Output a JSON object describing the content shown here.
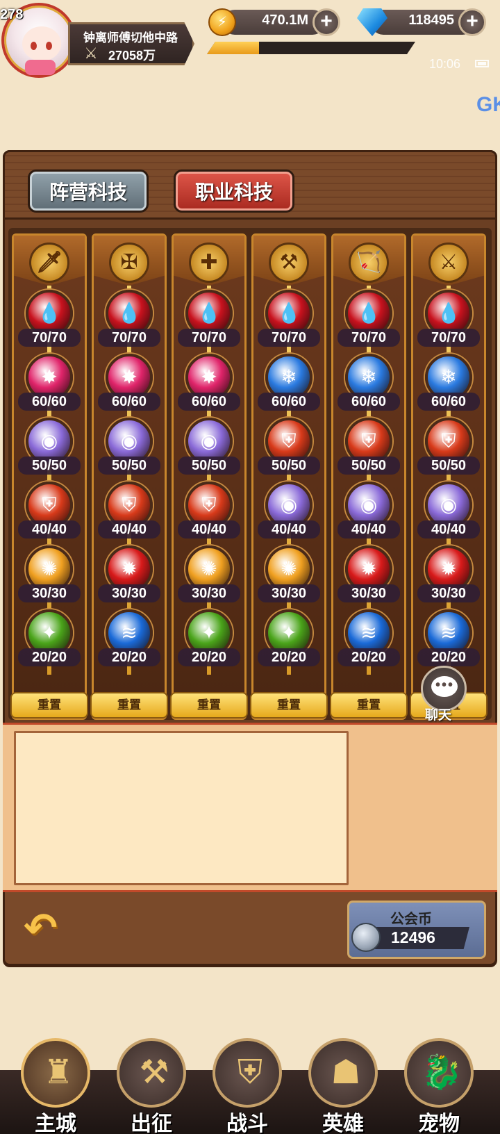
{
  "player": {
    "level": "278",
    "name": "钟离师傅切他中路",
    "power": "27058万"
  },
  "resources": {
    "gold": "470.1M",
    "gems": "118495",
    "exp_progress": 0.25
  },
  "status": {
    "time": "10:06",
    "corner_text": "GK"
  },
  "tabs": [
    {
      "label": "阵营科技",
      "active": false
    },
    {
      "label": "职业科技",
      "active": true
    }
  ],
  "class_icons": [
    "sword-class-icon",
    "mace-class-icon",
    "cross-class-icon",
    "axe-class-icon",
    "bow-class-icon",
    "scimitar-class-icon"
  ],
  "columns": [
    {
      "nodes": [
        {
          "type": "blood",
          "level": "70/70"
        },
        {
          "type": "pink-burst",
          "level": "60/60"
        },
        {
          "type": "purple-orb",
          "level": "50/50"
        },
        {
          "type": "red-shield",
          "level": "40/40"
        },
        {
          "type": "gold-blast",
          "level": "30/30"
        },
        {
          "type": "green-claw",
          "level": "20/20"
        }
      ],
      "reset": "重置"
    },
    {
      "nodes": [
        {
          "type": "blood",
          "level": "70/70"
        },
        {
          "type": "pink-burst",
          "level": "60/60"
        },
        {
          "type": "purple-orb",
          "level": "50/50"
        },
        {
          "type": "red-shield",
          "level": "40/40"
        },
        {
          "type": "red-star",
          "level": "30/30"
        },
        {
          "type": "blue-wind",
          "level": "20/20"
        }
      ],
      "reset": "重置"
    },
    {
      "nodes": [
        {
          "type": "blood",
          "level": "70/70"
        },
        {
          "type": "pink-burst",
          "level": "60/60"
        },
        {
          "type": "purple-orb",
          "level": "50/50"
        },
        {
          "type": "red-shield",
          "level": "40/40"
        },
        {
          "type": "gold-blast",
          "level": "30/30"
        },
        {
          "type": "green-claw",
          "level": "20/20"
        }
      ],
      "reset": "重置"
    },
    {
      "nodes": [
        {
          "type": "blood",
          "level": "70/70"
        },
        {
          "type": "blue-ice",
          "level": "60/60"
        },
        {
          "type": "red-shield",
          "level": "50/50"
        },
        {
          "type": "purple-orb",
          "level": "40/40"
        },
        {
          "type": "gold-blast",
          "level": "30/30"
        },
        {
          "type": "green-claw",
          "level": "20/20"
        }
      ],
      "reset": "重置"
    },
    {
      "nodes": [
        {
          "type": "blood",
          "level": "70/70"
        },
        {
          "type": "blue-ice",
          "level": "60/60"
        },
        {
          "type": "red-shield",
          "level": "50/50"
        },
        {
          "type": "purple-orb",
          "level": "40/40"
        },
        {
          "type": "red-star",
          "level": "30/30"
        },
        {
          "type": "blue-wind",
          "level": "20/20"
        }
      ],
      "reset": "重置"
    },
    {
      "nodes": [
        {
          "type": "blood",
          "level": "70/70"
        },
        {
          "type": "blue-ice",
          "level": "60/60"
        },
        {
          "type": "red-shield",
          "level": "50/50"
        },
        {
          "type": "purple-orb",
          "level": "40/40"
        },
        {
          "type": "red-star",
          "level": "30/30"
        },
        {
          "type": "blue-wind",
          "level": "20/20"
        }
      ],
      "reset": "重置"
    }
  ],
  "node_colors": {
    "blood": "#c8121e",
    "pink-burst": "#e0246a",
    "purple-orb": "#8a6ad8",
    "red-shield": "#d83a1a",
    "gold-blast": "#f0a020",
    "green-claw": "#4aa41a",
    "blue-wind": "#1a6ad8",
    "red-star": "#d81a1a",
    "blue-ice": "#2a7ae0"
  },
  "chat": {
    "label": "聊天"
  },
  "guild_coin": {
    "label": "公会币",
    "value": "12496"
  },
  "nav": [
    {
      "label": "主城",
      "icon": "castle-icon",
      "active": true
    },
    {
      "label": "出征",
      "icon": "crossed-axes-icon",
      "active": false
    },
    {
      "label": "战斗",
      "icon": "battle-shield-icon",
      "active": false
    },
    {
      "label": "英雄",
      "icon": "hooded-hero-icon",
      "active": false
    },
    {
      "label": "宠物",
      "icon": "dragon-pet-icon",
      "active": false
    }
  ]
}
